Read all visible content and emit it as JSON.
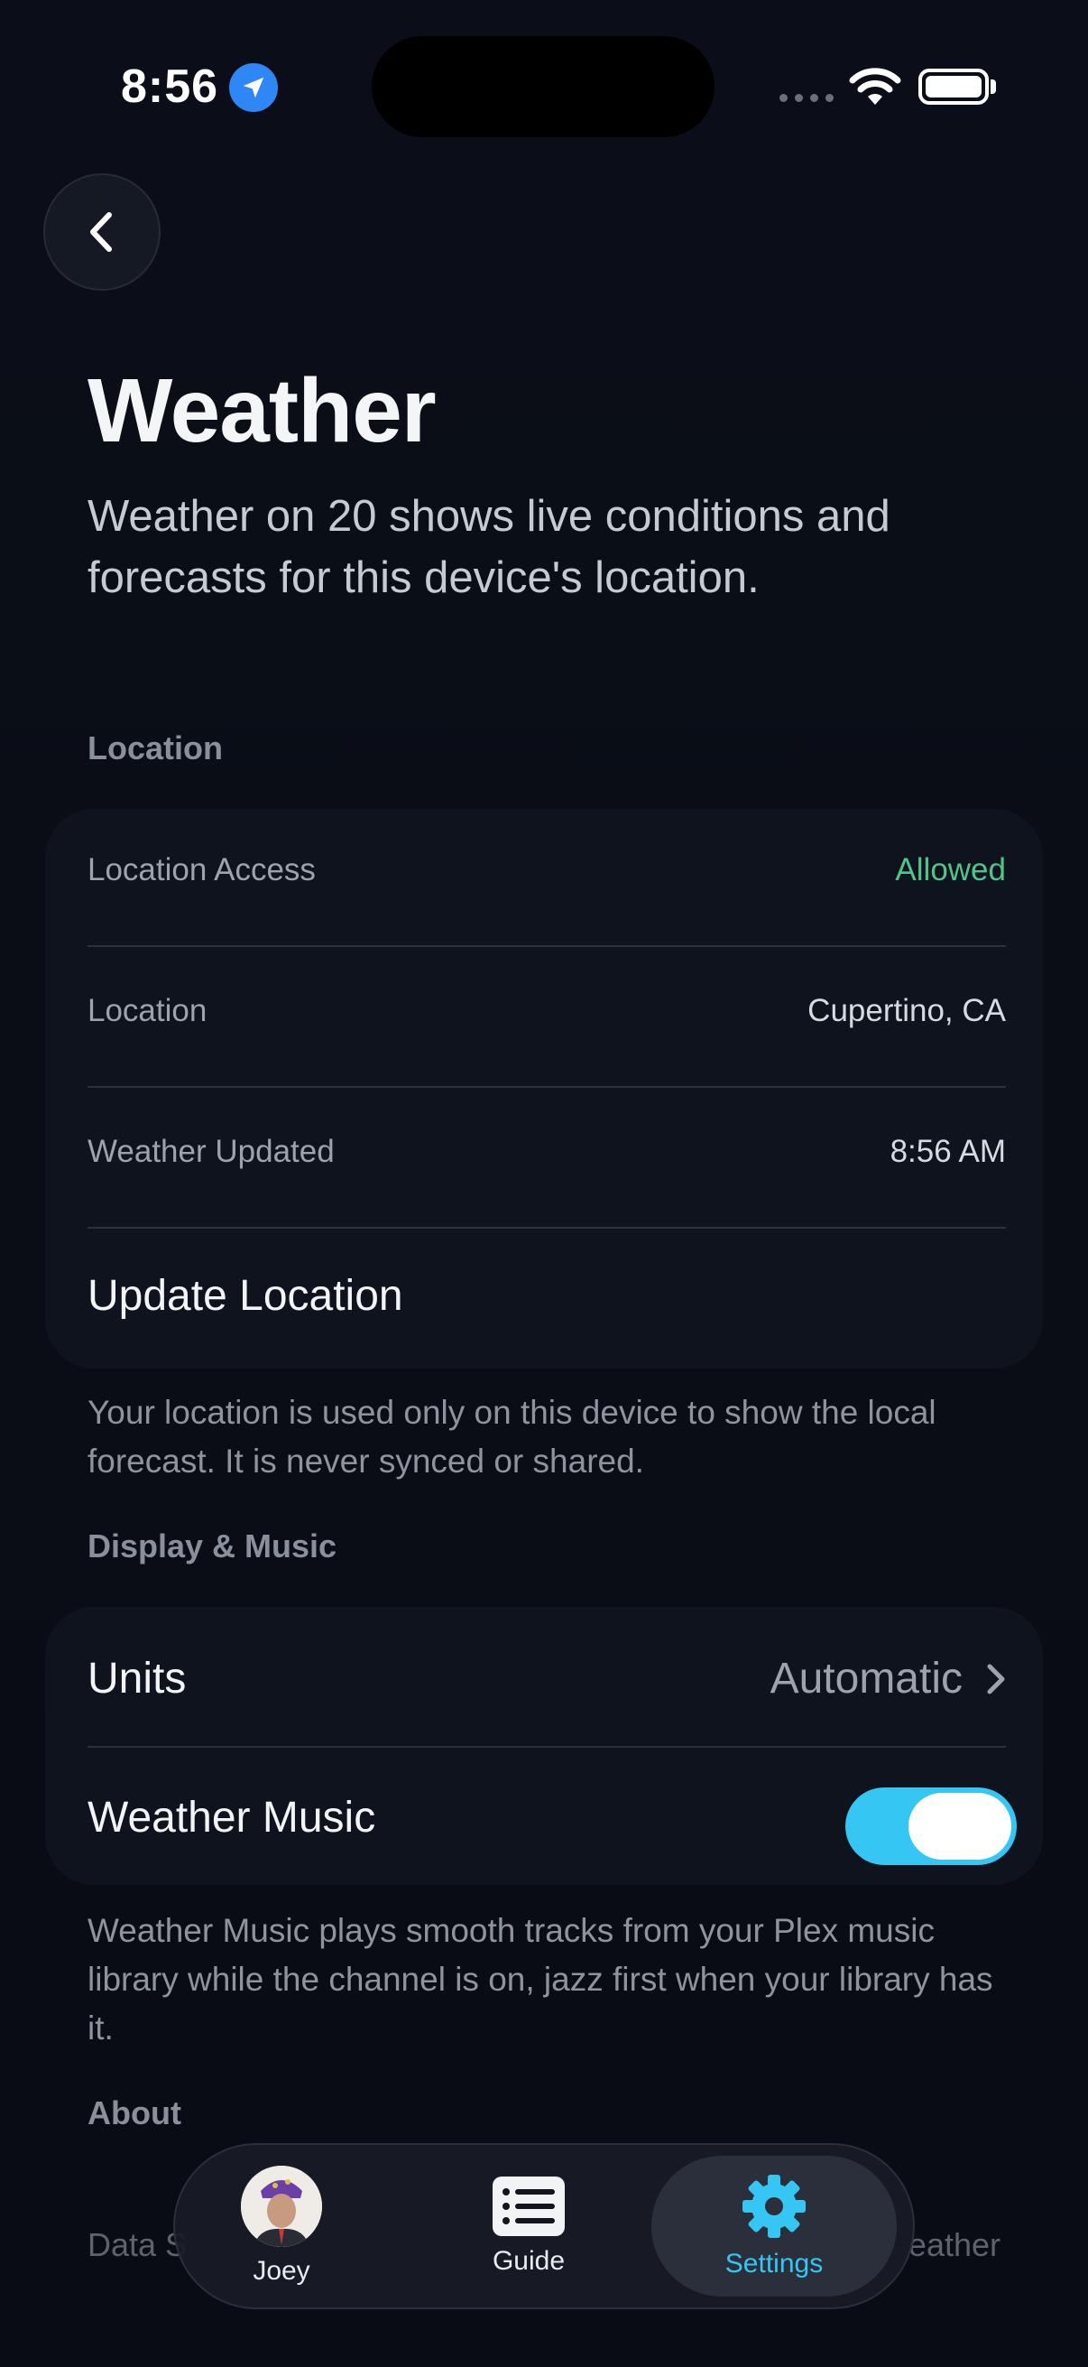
{
  "status_bar": {
    "time": "8:56"
  },
  "header": {
    "title": "Weather",
    "subtitle": "Weather on 20 shows live conditions and forecasts for this device's location."
  },
  "location_section": {
    "header": "Location",
    "rows": [
      {
        "label": "Location Access",
        "value": "Allowed"
      },
      {
        "label": "Location",
        "value": "Cupertino, CA"
      },
      {
        "label": "Weather Updated",
        "value": "8:56 AM"
      }
    ],
    "update_label": "Update Location",
    "footnote": "Your location is used only on this device to show the local forecast. It is never synced or shared."
  },
  "display_section": {
    "header": "Display & Music",
    "units_label": "Units",
    "units_value": "Automatic",
    "music_label": "Weather Music",
    "music_enabled": true,
    "footnote": "Weather Music plays smooth tracks from your Plex music library while the channel is on, jazz first when your library has it."
  },
  "about_section": {
    "header": "About",
    "data_source_label": "Data S",
    "data_source_value": "eather"
  },
  "tab_bar": {
    "tabs": [
      {
        "label": "Joey",
        "icon": "avatar-icon"
      },
      {
        "label": "Guide",
        "icon": "list-icon"
      },
      {
        "label": "Settings",
        "icon": "gear-icon",
        "active": true
      }
    ]
  },
  "colors": {
    "accent": "#36c6f4",
    "allowed": "#4fc58c",
    "background": "#0a0d16",
    "card": "#0f131d"
  }
}
